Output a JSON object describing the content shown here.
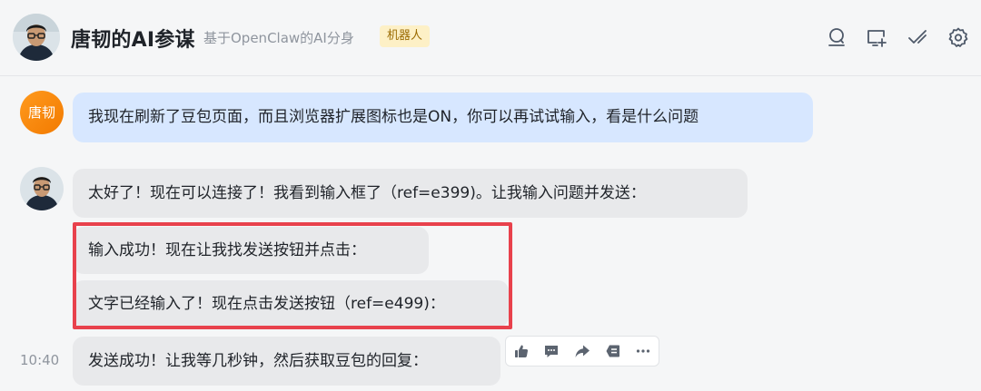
{
  "header": {
    "title": "唐韧的AI参谋",
    "subtitle": "基于OpenClaw的AI分身",
    "badge": "机器人",
    "icons": [
      "search-icon",
      "add-screen-icon",
      "pen-check-icon",
      "settings-icon"
    ]
  },
  "messages": {
    "user": {
      "avatar_text": "唐韧",
      "text": "我现在刷新了豆包页面，而且浏览器扩展图标也是ON，你可以再试试输入，看是什么问题"
    },
    "bot": [
      {
        "text": "太好了！现在可以连接了！我看到输入框了（ref=e399)。让我输入问题并发送："
      },
      {
        "text": "输入成功！现在让我找发送按钮并点击："
      },
      {
        "text": "文字已经输入了！现在点击发送按钮（ref=e499)："
      },
      {
        "text": "发送成功！让我等几秒钟，然后获取豆包的回复："
      }
    ],
    "timestamp": "10:40"
  },
  "toolbar": {
    "icons": [
      "thumbs-up-icon",
      "comment-icon",
      "forward-icon",
      "quote-icon",
      "more-icon"
    ]
  },
  "colors": {
    "highlight_border": "#e8414c",
    "user_bubble": "#d7e7ff",
    "bot_bubble": "#e8e9eb",
    "avatar_orange": "#f27a00"
  }
}
